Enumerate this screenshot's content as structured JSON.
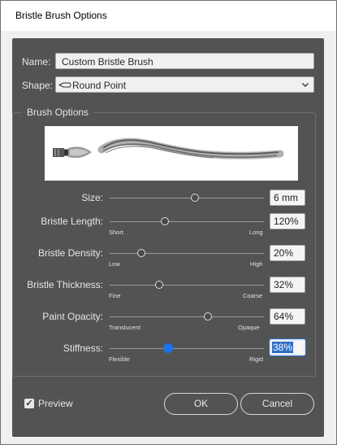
{
  "window": {
    "title": "Bristle Brush Options"
  },
  "name": {
    "label": "Name:",
    "value": "Custom Bristle Brush"
  },
  "shape": {
    "label": "Shape:",
    "value": "Round Point",
    "icon": "round-point-brush-icon",
    "chevron": "chevron-down-icon"
  },
  "brush_options": {
    "title": "Brush Options",
    "sliders": [
      {
        "label": "Size:",
        "min_label": "",
        "max_label": "",
        "value": "6 mm",
        "level": 0.55
      },
      {
        "label": "Bristle Length:",
        "min_label": "Short",
        "max_label": "Long",
        "value": "120%",
        "level": 0.36
      },
      {
        "label": "Bristle Density:",
        "min_label": "Low",
        "max_label": "High",
        "value": "20%",
        "level": 0.2
      },
      {
        "label": "Bristle Thickness:",
        "min_label": "Fine",
        "max_label": "Coarse",
        "value": "32%",
        "level": 0.32
      },
      {
        "label": "Paint Opacity:",
        "min_label": "Translucent",
        "max_label": "Opaque",
        "value": "64%",
        "level": 0.64
      },
      {
        "label": "Stiffness:",
        "min_label": "Flexible",
        "max_label": "Rigid",
        "value": "38%",
        "level": 0.38
      }
    ]
  },
  "preview_checkbox": {
    "label": "Preview",
    "checked": true
  },
  "buttons": {
    "ok": "OK",
    "cancel": "Cancel"
  },
  "colors": {
    "dialog_bg": "#535353",
    "accent": "#1a73e8",
    "selection": "#2f6dc5"
  }
}
